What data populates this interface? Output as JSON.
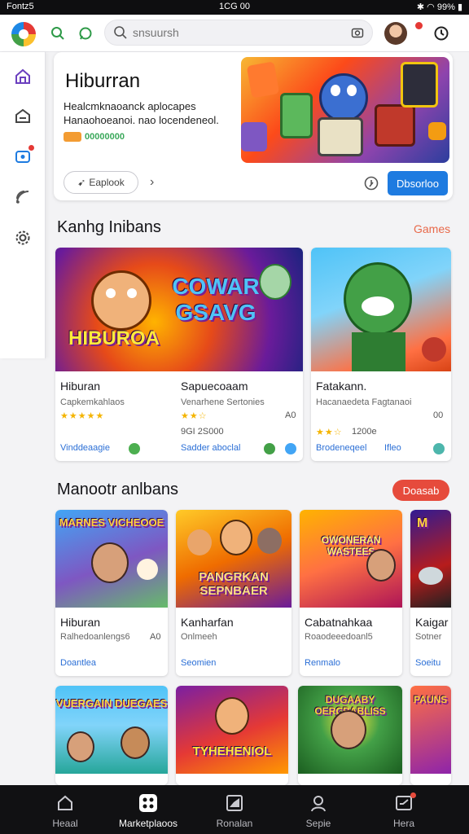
{
  "status_bar": {
    "left": "Fontz5",
    "time": "1CG 00",
    "battery": "99%"
  },
  "header": {
    "search_placeholder": "snsuursh"
  },
  "sidebar": {
    "items": [
      {
        "icon": "home-icon"
      },
      {
        "icon": "store-icon"
      },
      {
        "icon": "gamepad-icon"
      },
      {
        "icon": "feed-icon"
      },
      {
        "icon": "gear-icon"
      }
    ]
  },
  "hero": {
    "title": "Hiburran",
    "description": "Healcmknaoanck aplocapes Hanaohoeanoi. nao locendeneol.",
    "tag": "00000000",
    "explore_label": "Eaplook",
    "download_label": "Dbsorloo"
  },
  "section1": {
    "title": "Kanhg Inibans",
    "link": "Games",
    "cards": [
      {
        "art_text": "COWAR GSAVG",
        "art_sub": "HIBUROA",
        "title": "Hiburan",
        "subtitle": "Capkemkahlaos",
        "stars": "★★★★★",
        "footer": "Vinddeaagie"
      },
      {
        "title": "Sapuecoaam",
        "subtitle": "Venarhene Sertonies",
        "stars": "★★☆",
        "count": "A0",
        "meta": "9GI 2S000",
        "footer": "Sadder aboclal"
      },
      {
        "title": "Fatakann.",
        "subtitle": "Hacanaedeta Fagtanaoi",
        "stars": "★★☆",
        "count": "00",
        "meta": "1200e",
        "footer": "Brodeneqeel",
        "footer2": "Ifleo"
      }
    ]
  },
  "section2": {
    "title": "Manootr anlbans",
    "button": "Doasab",
    "cards": [
      {
        "art_text": "MARNES VICHEOOE",
        "title": "Hiburan",
        "subtitle": "Ralhedoanlengs6",
        "count": "A0",
        "footer": "Doantlea"
      },
      {
        "art_text": "PANGRKAN SEPNBAER",
        "title": "Kanharfan",
        "subtitle": "Onlmeeh",
        "footer": "Seomien"
      },
      {
        "art_text": "OWONERAN WASTEES",
        "title": "Cabatnahkaa",
        "subtitle": "Roaodeeedoanl5",
        "footer": "Renmalo"
      },
      {
        "art_text": "M",
        "title": "Kaigar",
        "subtitle": "Sotner",
        "footer": "Soeitu"
      },
      {
        "art_text": "VUERGAIN DUEGAES",
        "title": "",
        "subtitle": "",
        "footer": ""
      },
      {
        "art_text": "TYHEHENIOL",
        "title": "",
        "subtitle": "",
        "footer": ""
      },
      {
        "art_text": "DUGAABY OERCBABLISS",
        "title": "",
        "subtitle": "",
        "footer": ""
      },
      {
        "art_text": "PAUNS",
        "title": "",
        "subtitle": "",
        "footer": ""
      }
    ]
  },
  "bottom_nav": [
    {
      "label": "Heaal",
      "icon": "home-icon"
    },
    {
      "label": "Marketplaoos",
      "icon": "grid-icon",
      "active": true
    },
    {
      "label": "Ronalan",
      "icon": "image-icon"
    },
    {
      "label": "Sepie",
      "icon": "profile-icon"
    },
    {
      "label": "Hera",
      "icon": "inbox-icon"
    }
  ]
}
